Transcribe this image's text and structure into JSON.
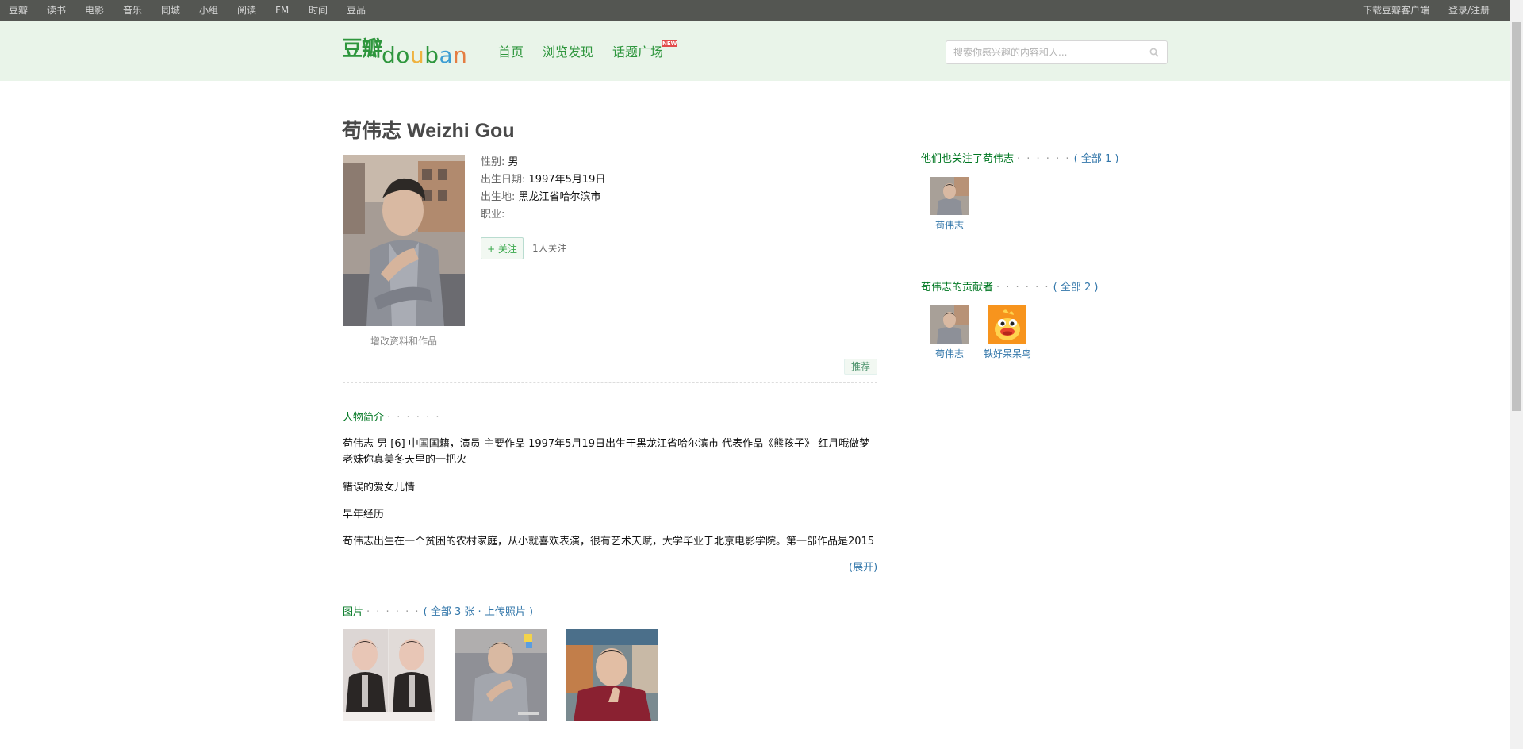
{
  "global_nav": {
    "left": [
      "豆瓣",
      "读书",
      "电影",
      "音乐",
      "同城",
      "小组",
      "阅读",
      "FM",
      "时间",
      "豆品"
    ],
    "right": [
      "下载豆瓣客户端",
      "登录/注册"
    ]
  },
  "header": {
    "logo_cn": "豆瓣",
    "logo_en": [
      "d",
      "o",
      "u",
      "b",
      "a",
      "n"
    ],
    "nav": [
      "首页",
      "浏览发现",
      "话题广场"
    ],
    "new_badge": "NEW",
    "search_placeholder": "搜索你感兴趣的内容和人..."
  },
  "profile": {
    "title": "苟伟志 Weizhi Gou",
    "edit_link": "增改资料和作品",
    "info": [
      {
        "label": "性别:",
        "value": "男"
      },
      {
        "label": "出生日期:",
        "value": "1997年5月19日"
      },
      {
        "label": "出生地:",
        "value": "黑龙江省哈尔滨市"
      },
      {
        "label": "职业:",
        "value": ""
      }
    ],
    "follow_label": "+ 关注",
    "follower_count": "1人关注",
    "recommend_label": "推荐"
  },
  "bio": {
    "title": "人物简介",
    "dots": "· · · · · ·",
    "paragraphs": [
      "苟伟志 男 [6] 中国国籍，演员 主要作品 1997年5月19日出生于黑龙江省哈尔滨市 代表作品《熊孩子》 红月哦做梦老妹你真美冬天里的一把火",
      "错误的爱女儿情",
      "早年经历",
      "苟伟志出生在一个贫困的农村家庭，从小就喜欢表演，很有艺术天赋，大学毕业于北京电影学院。第一部作品是2015"
    ],
    "expand": "(展开)"
  },
  "photos": {
    "title": "图片",
    "dots": "· · · · · ·",
    "open_paren": "(",
    "all_link": "全部 3 张",
    "sep": "·",
    "upload_link": "上传照片",
    "close_paren": ")"
  },
  "sidebar": {
    "also_follow": {
      "title": "他们也关注了苟伟志",
      "dots": "· · · · · ·",
      "open_paren": "(",
      "all": "全部 1",
      "close_paren": ")",
      "people": [
        "苟伟志"
      ]
    },
    "contributors": {
      "title": "苟伟志的贡献者",
      "dots": "· · · · · ·",
      "open_paren": "(",
      "all": "全部 2",
      "close_paren": ")",
      "people": [
        "苟伟志",
        "铁好呆呆鸟"
      ]
    }
  },
  "colors": {
    "top_bar": "#545652",
    "header_bg": "#e9f4e9",
    "brand_green": "#2e963d",
    "section_green": "#007722",
    "link_blue": "#3377aa"
  }
}
